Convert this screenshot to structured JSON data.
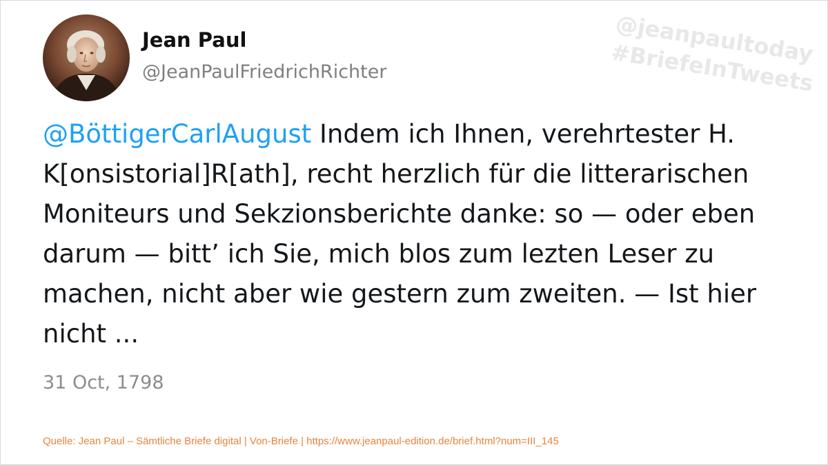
{
  "profile": {
    "display_name": "Jean Paul",
    "handle": "@JeanPaulFriedrichRichter",
    "avatar_icon": "portrait-avatar"
  },
  "watermark": {
    "line1": "@jeanpaultoday",
    "line2": "#BriefeInTweets"
  },
  "tweet": {
    "mention": "@BöttigerCarlAugust",
    "text": " Indem ich Ihnen, verehrtester H. K[onsistorial]R[ath], recht herzlich für die litterarischen Moniteurs und Sekzionsberichte danke: so — oder eben darum — bitt’ ich Sie, mich blos zum lezten Leser zu machen, nicht aber wie gestern zum zweiten. — Ist hier nicht ...",
    "date": "31 Oct, 1798"
  },
  "source": {
    "text": "Quelle: Jean Paul – Sämtliche Briefe digital | Von-Briefe | https://www.jeanpaul-edition.de/brief.html?num=III_145"
  },
  "colors": {
    "mention": "#1da1f2",
    "source": "#e8843a",
    "text": "#14171a",
    "muted": "#7f7f7f"
  }
}
